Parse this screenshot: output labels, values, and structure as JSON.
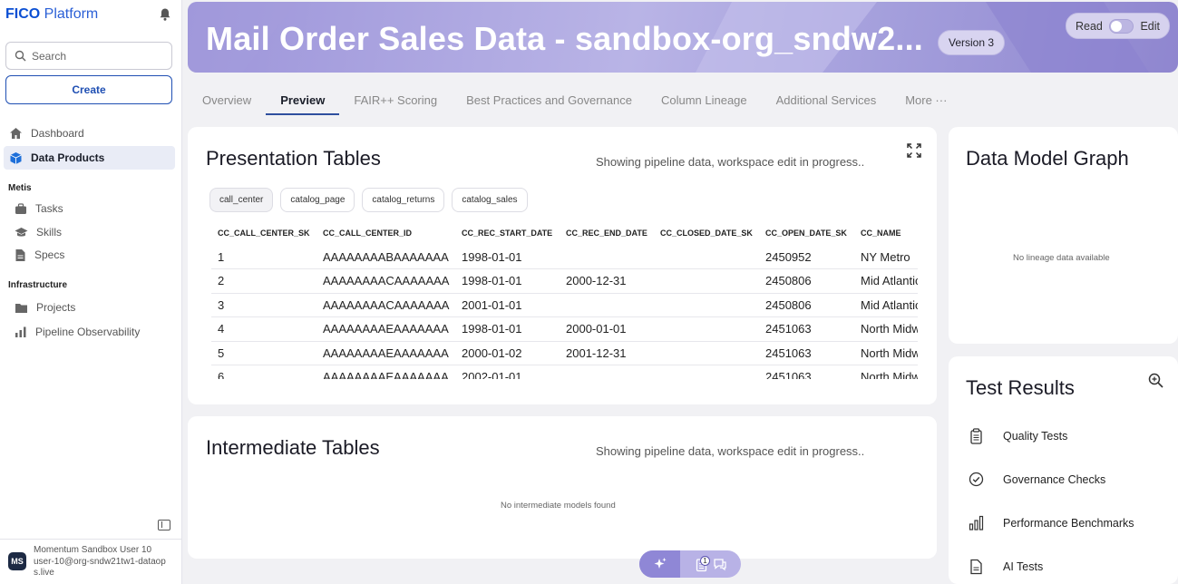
{
  "brand": {
    "name_bold": "FICO",
    "name_rest": "Platform"
  },
  "search": {
    "placeholder": "Search"
  },
  "create_label": "Create",
  "nav": {
    "dashboard": "Dashboard",
    "data_products": "Data Products",
    "metis_section": "Metis",
    "tasks": "Tasks",
    "skills": "Skills",
    "specs": "Specs",
    "infra_section": "Infrastructure",
    "projects": "Projects",
    "pipeline": "Pipeline Observability"
  },
  "user": {
    "initials": "MS",
    "name": "Momentum Sandbox User 10",
    "email": "user-10@org-sndw21tw1-dataops.live"
  },
  "hero": {
    "title": "Mail Order Sales Data - sandbox-org_sndw2...",
    "version": "Version 3",
    "mode_read": "Read",
    "mode_edit": "Edit"
  },
  "tabs": [
    "Overview",
    "Preview",
    "FAIR++ Scoring",
    "Best Practices and Governance",
    "Column Lineage",
    "Additional Services",
    "More ···"
  ],
  "presentation": {
    "title": "Presentation Tables",
    "status": "Showing pipeline data, workspace edit in progress..",
    "chips": [
      "call_center",
      "catalog_page",
      "catalog_returns",
      "catalog_sales"
    ],
    "columns": [
      "CC_CALL_CENTER_SK",
      "CC_CALL_CENTER_ID",
      "CC_REC_START_DATE",
      "CC_REC_END_DATE",
      "CC_CLOSED_DATE_SK",
      "CC_OPEN_DATE_SK",
      "CC_NAME"
    ],
    "rows": [
      [
        "1",
        "AAAAAAAABAAAAAAA",
        "1998-01-01",
        "",
        "",
        "2450952",
        "NY Metro"
      ],
      [
        "2",
        "AAAAAAAACAAAAAAA",
        "1998-01-01",
        "2000-12-31",
        "",
        "2450806",
        "Mid Atlantic"
      ],
      [
        "3",
        "AAAAAAAACAAAAAAA",
        "2001-01-01",
        "",
        "",
        "2450806",
        "Mid Atlantic"
      ],
      [
        "4",
        "AAAAAAAAEAAAAAAA",
        "1998-01-01",
        "2000-01-01",
        "",
        "2451063",
        "North Midwest"
      ],
      [
        "5",
        "AAAAAAAAEAAAAAAA",
        "2000-01-02",
        "2001-12-31",
        "",
        "2451063",
        "North Midwest"
      ],
      [
        "6",
        "AAAAAAAAEAAAAAAA",
        "2002-01-01",
        "",
        "",
        "2451063",
        "North Midwest"
      ]
    ]
  },
  "intermediate": {
    "title": "Intermediate Tables",
    "status": "Showing pipeline data, workspace edit in progress..",
    "empty": "No intermediate models found"
  },
  "graph": {
    "title": "Data Model Graph",
    "empty": "No lineage data available"
  },
  "tests": {
    "title": "Test Results",
    "items": [
      "Quality Tests",
      "Governance Checks",
      "Performance Benchmarks",
      "AI Tests"
    ]
  },
  "fab": {
    "badge": "1"
  }
}
